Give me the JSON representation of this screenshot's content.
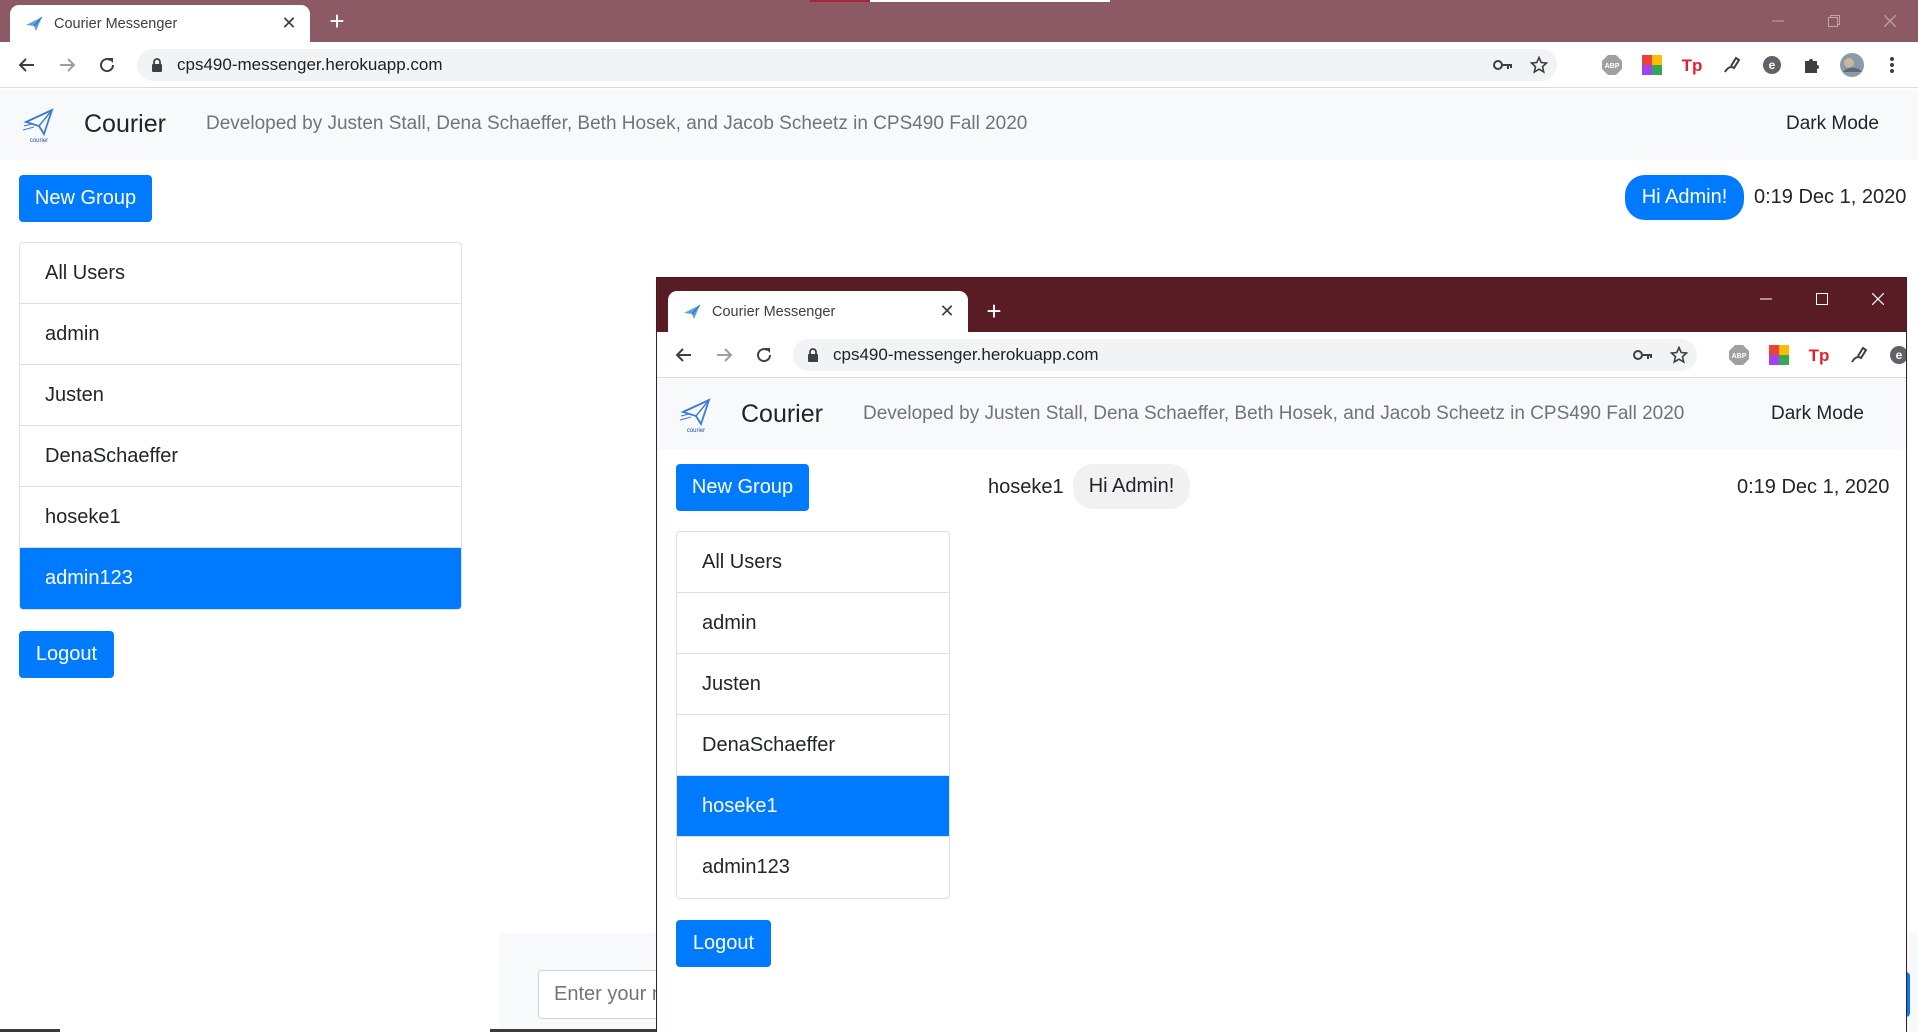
{
  "main_window": {
    "tab_title": "Courier Messenger",
    "url": "cps490-messenger.herokuapp.com",
    "titlebar_color": "#8b5a64",
    "app": {
      "brand": "Courier",
      "logo_caption": "courier",
      "credits": "Developed by Justen Stall, Dena Schaeffer, Beth Hosek, and Jacob Scheetz in CPS490 Fall 2020",
      "dark_mode": "Dark Mode",
      "new_group": "New Group",
      "users": [
        "All Users",
        "admin",
        "Justen",
        "DenaSchaeffer",
        "hoseke1",
        "admin123"
      ],
      "active_user": "admin123",
      "logout": "Logout",
      "message": {
        "text": "Hi Admin!",
        "time": "0:19 Dec 1, 2020"
      },
      "input_placeholder": "Enter your message"
    }
  },
  "second_window": {
    "tab_title": "Courier Messenger",
    "url": "cps490-messenger.herokuapp.com",
    "titlebar_color": "#5a1c24",
    "app": {
      "brand": "Courier",
      "logo_caption": "courier",
      "credits": "Developed by Justen Stall, Dena Schaeffer, Beth Hosek, and Jacob Scheetz in CPS490 Fall 2020",
      "dark_mode": "Dark Mode",
      "new_group": "New Group",
      "users": [
        "All Users",
        "admin",
        "Justen",
        "DenaSchaeffer",
        "hoseke1",
        "admin123"
      ],
      "active_user": "hoseke1",
      "logout": "Logout",
      "message": {
        "sender": "hoseke1",
        "text": "Hi Admin!",
        "time": "0:19 Dec 1, 2020"
      }
    }
  },
  "icons": {
    "back": "back-arrow-icon",
    "forward": "forward-arrow-icon",
    "reload": "reload-icon",
    "lock": "lock-icon",
    "key": "key-icon",
    "star": "bookmark-star-icon",
    "extensions": [
      "abp-icon",
      "colorful-grid-icon",
      "tp-icon",
      "pen-icon",
      "circle-e-icon",
      "puzzle-icon",
      "profile-avatar-icon",
      "kebab-menu-icon"
    ]
  },
  "colors": {
    "primary": "#007bff",
    "navbar_bg": "#f8f9fa",
    "muted_text": "#6c757d",
    "received_bubble": "#f1f1f1",
    "abp_badge": "#a0a0a0",
    "tp_red": "#e4202e"
  }
}
